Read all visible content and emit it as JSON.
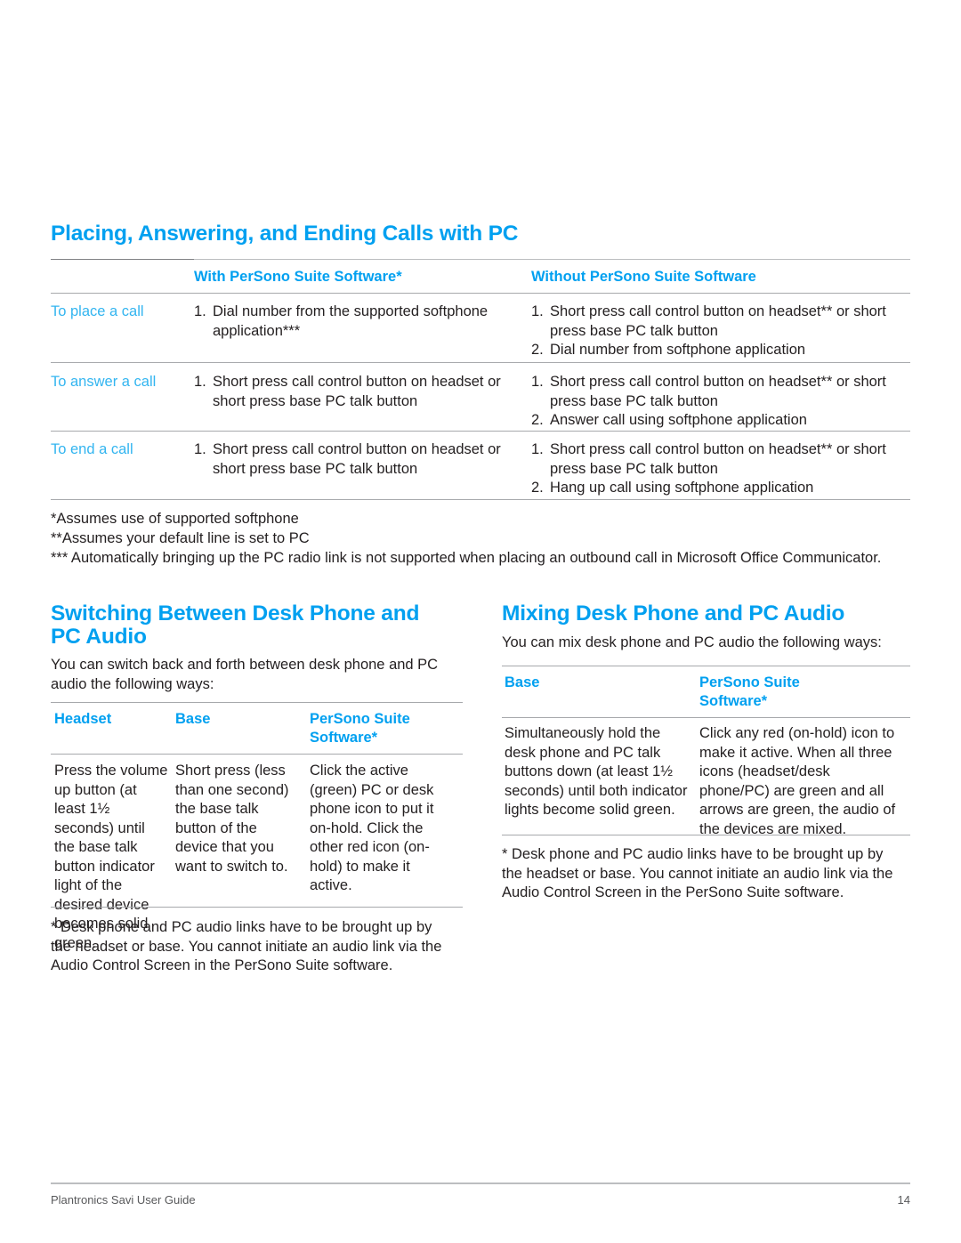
{
  "page": {
    "number": "14",
    "footer_text": "Plantronics Savi User Guide",
    "accent_color": "#00a0f0",
    "row_label_color": "#33b5f0",
    "rule_color": "#a7a9ac"
  },
  "section_pc_calls": {
    "heading": "Placing, Answering, and Ending Calls with PC",
    "columns": [
      "",
      "With PerSono Suite Software*",
      "Without PerSono Suite Software"
    ],
    "rows": [
      {
        "label": "To place a call",
        "with_software": [
          "Dial number from the supported softphone application***"
        ],
        "without_software": [
          "Short press call control button on headset** or short press base PC talk button",
          "Dial number from softphone application"
        ]
      },
      {
        "label": "To answer a call",
        "with_software": [
          "Short press call control button on headset or short press base PC talk button"
        ],
        "without_software": [
          "Short press call control button on headset** or short press base PC talk button",
          "Answer call using softphone application"
        ]
      },
      {
        "label": "To end a call",
        "with_software": [
          "Short press call control button on headset or short press base PC talk button"
        ],
        "without_software": [
          "Short press call control button on headset** or short press base PC talk button",
          "Hang up call using softphone application"
        ]
      }
    ],
    "footnotes": [
      "*Assumes use of supported softphone",
      "**Assumes your default line is set to PC",
      "*** Automatically bringing up the PC radio link is not supported when placing an outbound call in Microsoft Office Communicator."
    ]
  },
  "section_switching": {
    "heading_line1": "Switching Between Desk Phone and",
    "heading_line2": "PC Audio",
    "intro": "You can switch back and forth between desk phone and PC audio the following ways:",
    "columns": [
      {
        "line1": "Headset",
        "line2": ""
      },
      {
        "line1": "Base",
        "line2": ""
      },
      {
        "line1": "PerSono Suite",
        "line2": "Software*"
      }
    ],
    "cells": [
      "Press the volume up button (at least 1½ seconds) until the base talk button indicator light of the desired device becomes solid green.",
      "Short press (less than one second) the base talk button of the device that you want to switch to.",
      "Click the active (green) PC or desk phone icon to put it on-hold. Click the other red icon (on-hold) to make it active."
    ],
    "footnote": "* Desk phone and PC audio links have to be brought up by the headset or base. You cannot initiate an audio link via the Audio Control Screen in the PerSono Suite software."
  },
  "section_mixing": {
    "heading": "Mixing Desk Phone and PC Audio",
    "intro": "You can mix desk phone and PC audio the following ways:",
    "columns": [
      {
        "line1": "Base",
        "line2": ""
      },
      {
        "line1": "PerSono Suite",
        "line2": "Software*"
      }
    ],
    "cells": [
      "Simultaneously hold the desk phone and PC talk buttons down (at least 1½ seconds) until both indicator lights become solid green.",
      "Click any red (on-hold) icon to make it active. When all three icons (headset/desk phone/PC) are green and all arrows are green, the audio of the devices are mixed."
    ],
    "footnote": "* Desk phone and PC audio links have to be brought up by the headset or base. You cannot initiate an audio link via the Audio Control Screen in the PerSono Suite software."
  }
}
